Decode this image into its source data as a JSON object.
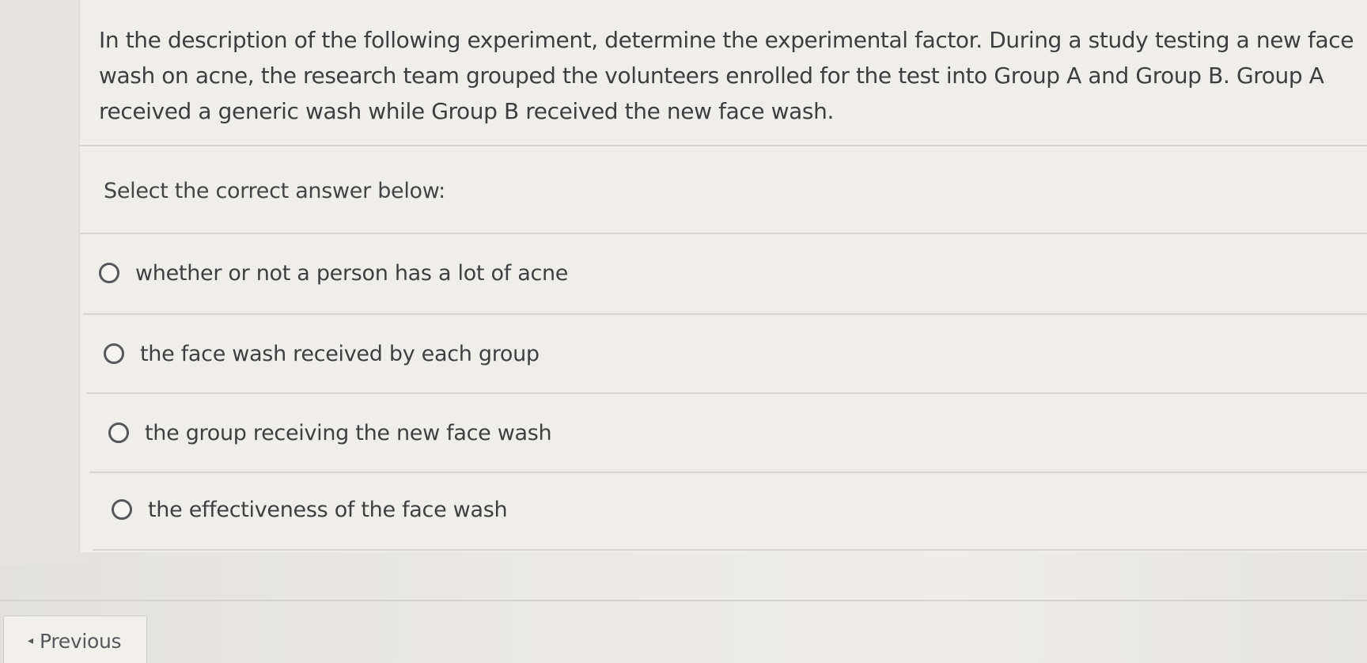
{
  "question": {
    "text": "In the description of the following experiment, determine the experimental factor. During a study testing a new face wash on acne, the research team grouped the volunteers enrolled for the test into Group A and Group B. Group A received a generic wash while Group B received the new face wash.",
    "prompt": "Select the correct answer below:"
  },
  "options": [
    {
      "label": "whether or not a person has a lot of acne",
      "selected": false
    },
    {
      "label": "the face wash received by each group",
      "selected": false
    },
    {
      "label": "the group receiving the new face wash",
      "selected": false
    },
    {
      "label": "the effectiveness of the face wash",
      "selected": false
    }
  ],
  "navigation": {
    "previous_icon": "◂",
    "previous_label": "Previous"
  }
}
